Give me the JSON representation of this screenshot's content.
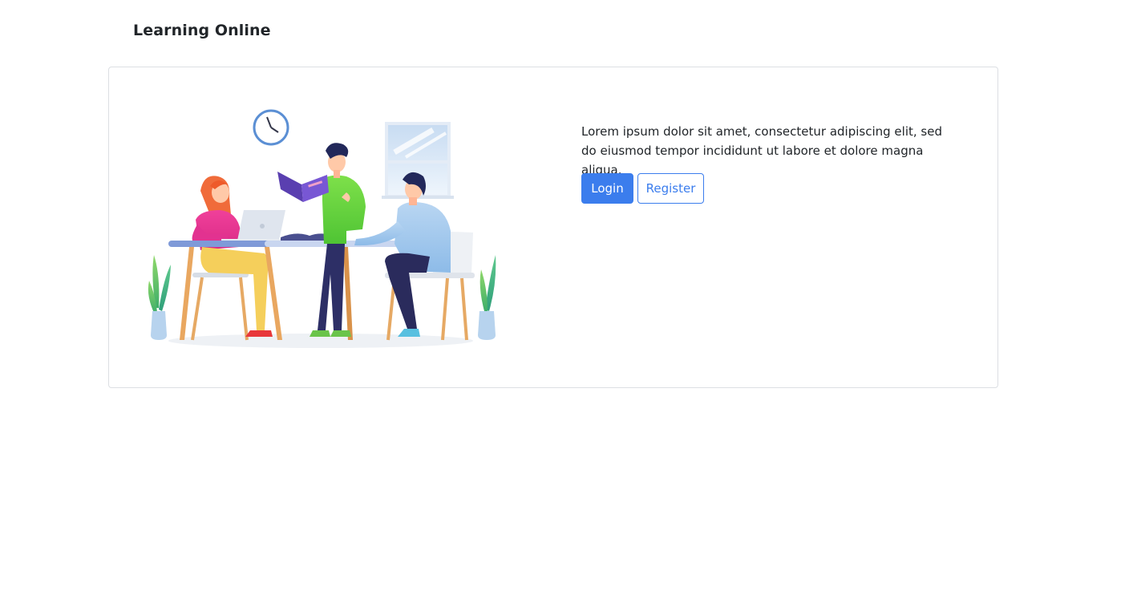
{
  "header": {
    "brand": "Learning Online"
  },
  "hero": {
    "illustration": "people-studying-at-table-illustration",
    "description": "Lorem ipsum dolor sit amet, consectetur adipiscing elit, sed do eiusmod tempor incididunt ut labore et dolore magna aliqua.",
    "login_label": "Login",
    "register_label": "Register"
  },
  "colors": {
    "primary": "#3b7ded",
    "text": "#212529",
    "card_border": "#dcdfe3"
  }
}
